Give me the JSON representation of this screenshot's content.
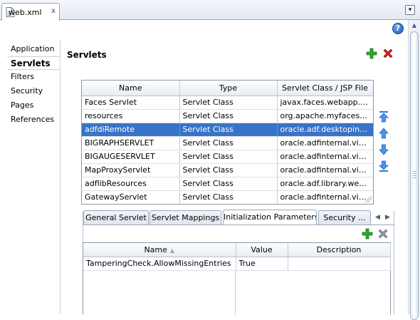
{
  "editor_tab": {
    "filename": "web.xml",
    "close": "x"
  },
  "tab_menu": "▾",
  "help": "?",
  "nav": {
    "items": [
      {
        "label": "Application",
        "selected": false
      },
      {
        "label": "Servlets",
        "selected": true
      },
      {
        "label": "Filters",
        "selected": false
      },
      {
        "label": "Security",
        "selected": false
      },
      {
        "label": "Pages",
        "selected": false
      },
      {
        "label": "References",
        "selected": false
      }
    ]
  },
  "section": {
    "title": "Servlets"
  },
  "servlets_table": {
    "columns": [
      "Name",
      "Type",
      "Servlet Class / JSP File"
    ],
    "rows": [
      [
        "Faces Servlet",
        "Servlet Class",
        "javax.faces.webapp.F..."
      ],
      [
        "resources",
        "Servlet Class",
        "org.apache.myfaces.tri..."
      ],
      [
        "adfdiRemote",
        "Servlet Class",
        "oracle.adf.desktopinte..."
      ],
      [
        "BIGRAPHSERVLET",
        "Servlet Class",
        "oracle.adfinternal.view..."
      ],
      [
        "BIGAUGESERVLET",
        "Servlet Class",
        "oracle.adfinternal.view..."
      ],
      [
        "MapProxyServlet",
        "Servlet Class",
        "oracle.adfinternal.view..."
      ],
      [
        "adflibResources",
        "Servlet Class",
        "oracle.adf.library.weba..."
      ],
      [
        "GatewayServlet",
        "Servlet Class",
        "oracle.adfinternal.view..."
      ]
    ],
    "selected_row": 2
  },
  "sub_tabs": [
    {
      "label": "General Servlet",
      "active": false
    },
    {
      "label": "Servlet Mappings",
      "active": false
    },
    {
      "label": "Initialization Parameters",
      "active": true
    },
    {
      "label": "Security ...",
      "active": false
    }
  ],
  "params_table": {
    "columns": [
      "Name",
      "Value",
      "Description"
    ],
    "rows": [
      [
        "TamperingCheck.AllowMissingEntries",
        "True",
        ""
      ]
    ]
  },
  "colors": {
    "selection": "#3873c8",
    "add": "#2fa52f",
    "delete": "#d22020",
    "arrow": "#2f7ad8"
  }
}
